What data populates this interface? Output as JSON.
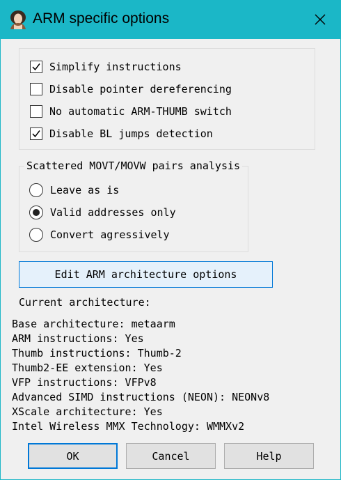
{
  "window": {
    "title": "ARM specific options",
    "app_icon": "app-portrait-icon",
    "close_icon": "close-icon"
  },
  "options": {
    "items": [
      {
        "label": "Simplify instructions",
        "checked": true
      },
      {
        "label": "Disable pointer dereferencing",
        "checked": false
      },
      {
        "label": "No automatic ARM-THUMB switch",
        "checked": false
      },
      {
        "label": "Disable BL jumps detection",
        "checked": true
      }
    ]
  },
  "movt_group": {
    "legend": "Scattered MOVT/MOVW pairs analysis",
    "items": [
      {
        "label": "Leave as is",
        "selected": false
      },
      {
        "label": "Valid addresses only",
        "selected": true
      },
      {
        "label": "Convert agressively",
        "selected": false
      }
    ]
  },
  "edit_button": {
    "label": "Edit ARM architecture options"
  },
  "current_arch": {
    "heading": "Current architecture:",
    "lines": [
      "Base architecture: metaarm",
      "ARM instructions: Yes",
      "Thumb instructions: Thumb-2",
      "Thumb2-EE extension: Yes",
      "VFP instructions: VFPv8",
      "Advanced SIMD instructions (NEON): NEONv8",
      "XScale architecture: Yes",
      "Intel Wireless MMX Technology: WMMXv2"
    ]
  },
  "buttons": {
    "ok": "OK",
    "cancel": "Cancel",
    "help": "Help"
  },
  "colors": {
    "titlebar": "#1bb7c7",
    "focus": "#0078d7",
    "edit_button_bg": "#e5f1fb"
  }
}
